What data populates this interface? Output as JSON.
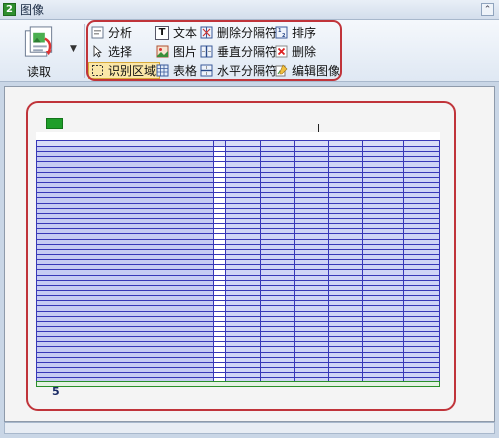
{
  "window": {
    "title": "图像",
    "badge": "2",
    "pin": "⌃"
  },
  "ribbon": {
    "read_label": "读取",
    "tools": {
      "analyze": "分析",
      "select": "选择",
      "recognize_area": "识别区域",
      "text": "文本",
      "image": "图片",
      "table": "表格",
      "delete_separator": "删除分隔符",
      "vertical_separator": "垂直分隔符",
      "horizontal_separator": "水平分隔符",
      "sort": "排序",
      "delete": "删除",
      "edit_image": "编辑图像"
    },
    "selected_tool": "recognize_area"
  },
  "document": {
    "page_number_marker": "5",
    "row_count": 46
  },
  "colors": {
    "highlight": "#c0343a",
    "table_line": "#3838b8",
    "table_fill": "#cfd4f6",
    "accent_green": "#1f9e2a"
  }
}
